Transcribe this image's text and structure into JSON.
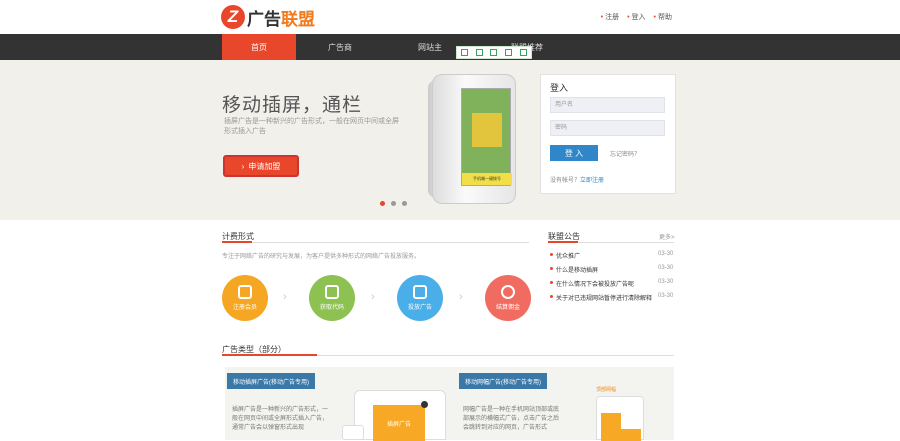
{
  "header": {
    "logo_letter": "Z",
    "logo_text_1": "广告",
    "logo_text_2": "联盟",
    "links": [
      "注册",
      "登入",
      "帮助"
    ]
  },
  "nav": {
    "items": [
      "首页",
      "广告商",
      "网站主",
      "联盟推荐"
    ]
  },
  "banner": {
    "title": "移动插屏，通栏",
    "description": "插屏广告是一种新兴的广告形式，一般在网页中间或全屏形式插入广告",
    "apply_button": "申请加盟",
    "phone_banner_text": "手机端一键拨号"
  },
  "login": {
    "title": "登入",
    "username_placeholder": "用户名",
    "password_placeholder": "密码",
    "login_button": "登 入",
    "forgot_link": "忘记密码？",
    "no_account": "没有帐号？",
    "register_link": "立即注册"
  },
  "billing": {
    "title": "计费形式",
    "description": "专注于网络广告的研究与发展，为客户提供多种形式的网络广告投放服务。",
    "items": [
      "注册会员",
      "获取代码",
      "投放广告",
      "结算佣金"
    ]
  },
  "notices": {
    "title": "联盟公告",
    "more": "更多>",
    "items": [
      {
        "title": "优众推广",
        "date": "03-30"
      },
      {
        "title": "什么是移动插屏",
        "date": "03-30"
      },
      {
        "title": "在什么情况下会被投放广告呢",
        "date": "03-30"
      },
      {
        "title": "关于对已违规网站暂停进行清除解释",
        "date": "03-30"
      }
    ]
  },
  "ad_types": {
    "title": "广告类型（部分）",
    "cards": [
      {
        "label": "移动插屏广告(移动广告专用)",
        "text": "插屏广告是一种新兴的广告形式，一般在网页中间或全屏形式插入广告，通常广告会以弹窗形式出现",
        "mock_text": "插屏广告"
      },
      {
        "label": "移动网幅广告(移动广告专用)",
        "text": "网幅广告是一种在手机网站顶部或底部展示的横幅式广告，点击广告之后会跳转到对应的网页，广告形式",
        "mock_text": "顶部网幅"
      }
    ]
  },
  "colors": {
    "accent": "#e8472b",
    "nav_bg": "#333333",
    "blue": "#2f86c8",
    "circles": [
      "#f5a623",
      "#8dc152",
      "#4aaee8",
      "#f06c61"
    ]
  }
}
